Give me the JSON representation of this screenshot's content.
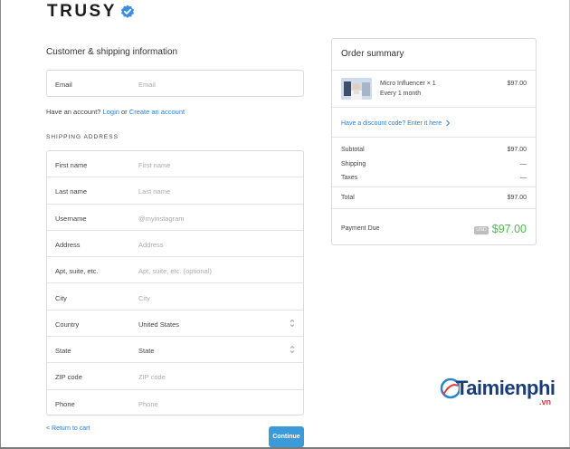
{
  "brand": {
    "name": "TRUSY"
  },
  "customer": {
    "section_title": "Customer & shipping information",
    "email": {
      "label": "Email",
      "placeholder": "Email"
    },
    "account_prompt": "Have an account?",
    "login_label": "Login",
    "or_text": "or",
    "create_label": "Create an account"
  },
  "shipping": {
    "heading": "SHIPPING ADDRESS",
    "fields": [
      {
        "label": "First name",
        "placeholder": "First name"
      },
      {
        "label": "Last name",
        "placeholder": "Last name"
      },
      {
        "label": "Username",
        "placeholder": "@myinstagram"
      },
      {
        "label": "Address",
        "placeholder": "Address"
      },
      {
        "label": "Apt, suite, etc.",
        "placeholder": "Apt, suite, etc. (optional)"
      },
      {
        "label": "City",
        "placeholder": "City"
      },
      {
        "label": "Country",
        "value": "United States"
      },
      {
        "label": "State",
        "value": "State"
      },
      {
        "label": "ZIP code",
        "placeholder": "ZIP code"
      },
      {
        "label": "Phone",
        "placeholder": "Phone"
      }
    ]
  },
  "nav": {
    "return_label": "< Return to cart",
    "continue_label": "Continue"
  },
  "summary": {
    "title": "Order summary",
    "product": {
      "name": "Micro Influencer × 1",
      "plan": "Every 1 month",
      "price": "$97.00"
    },
    "discount_label": "Have a discount code? Enter it here",
    "subtotal_label": "Subtotal",
    "subtotal_value": "$97.00",
    "shipping_label": "Shipping",
    "shipping_value": "—",
    "taxes_label": "Taxes",
    "taxes_value": "—",
    "total_label": "Total",
    "total_value": "$97.00",
    "due_label": "Payment Due",
    "currency": "USD",
    "due_value": "$97.00"
  },
  "watermark": {
    "text": "Taimienphi",
    "suffix": ".vn"
  },
  "colors": {
    "accent": "#3d9ad9",
    "link": "#2a7fd4",
    "due": "#52b552",
    "watermark": "#1a3d7a"
  }
}
